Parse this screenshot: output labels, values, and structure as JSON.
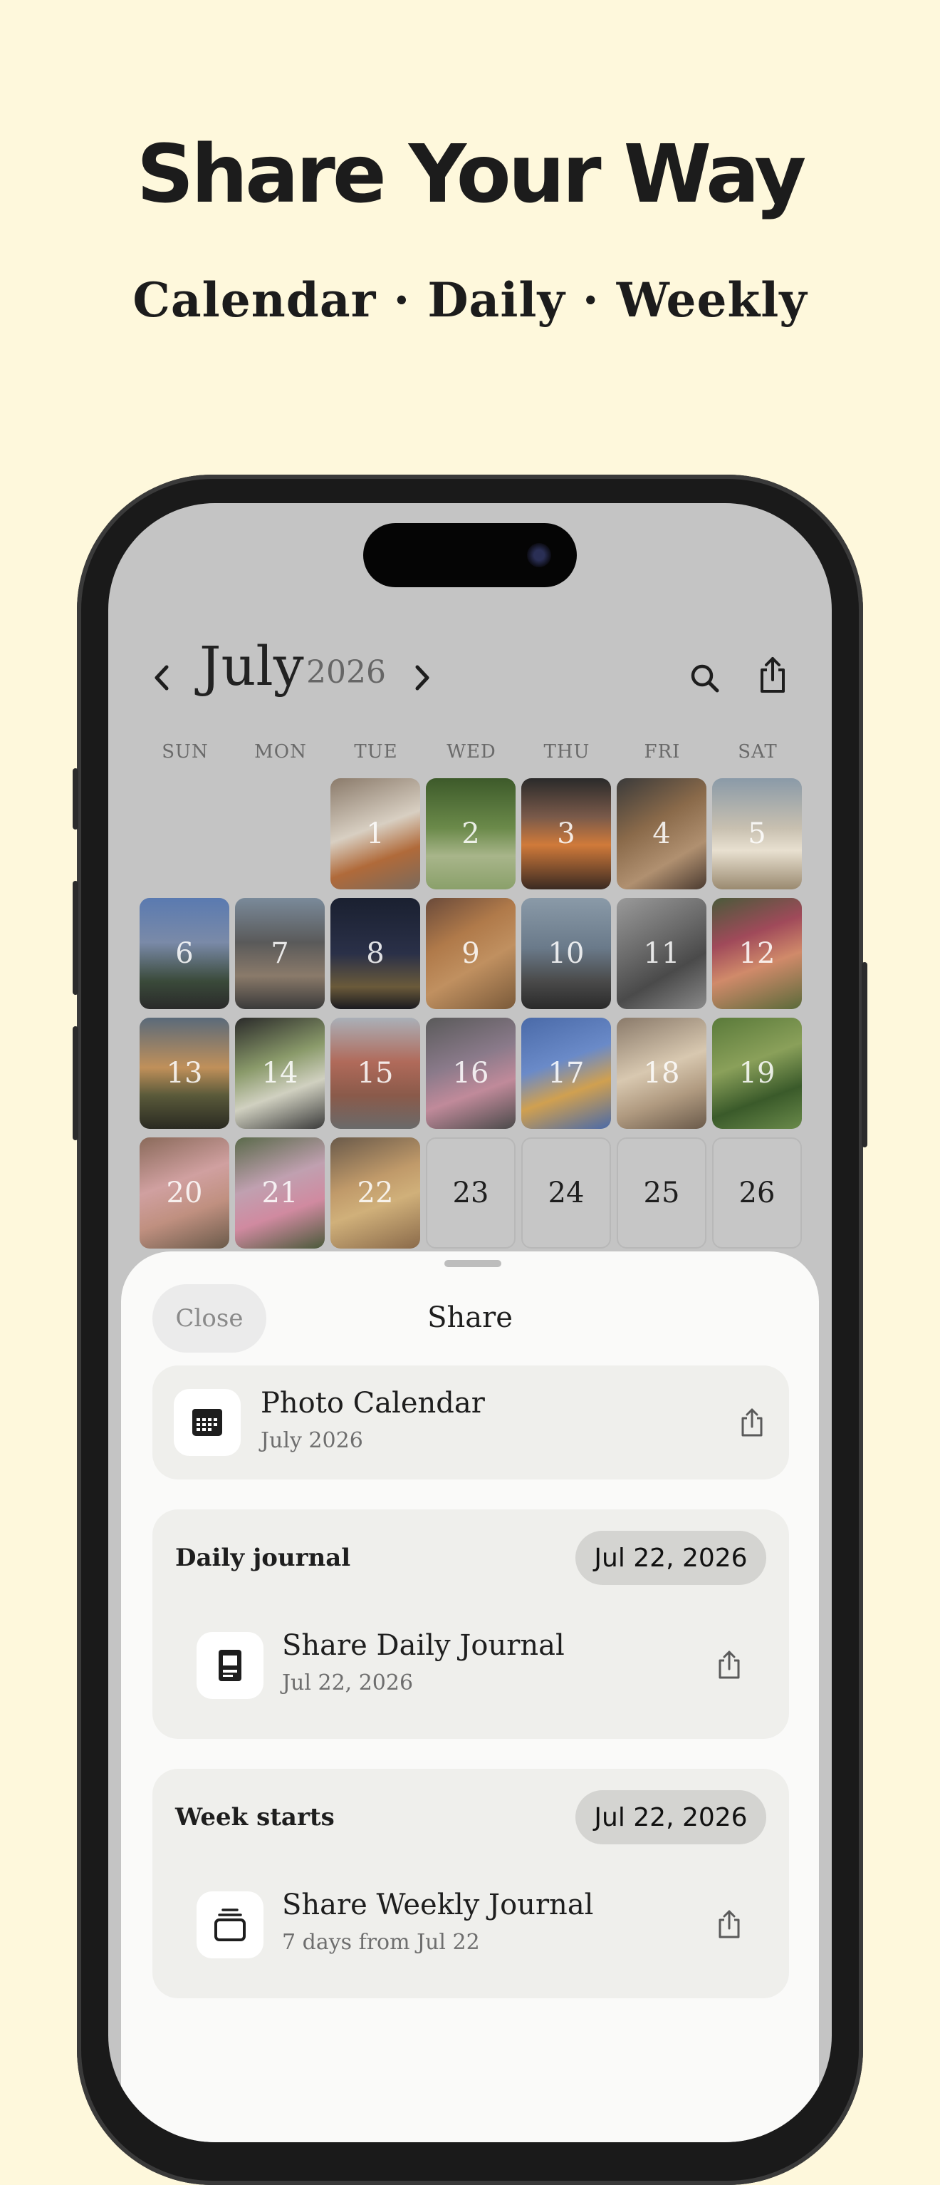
{
  "headline": "Share Your Way",
  "subhead": "Calendar · Daily · Weekly",
  "calendar": {
    "month": "July",
    "year": "2026",
    "weekdays": [
      "SUN",
      "MON",
      "TUE",
      "WED",
      "THU",
      "FRI",
      "SAT"
    ],
    "photo_days": [
      "1",
      "2",
      "3",
      "4",
      "5",
      "6",
      "7",
      "8",
      "9",
      "10",
      "11",
      "12",
      "13",
      "14",
      "15",
      "16",
      "17",
      "18",
      "19",
      "20",
      "21",
      "22"
    ],
    "empty_days": [
      "23",
      "24",
      "25",
      "26"
    ]
  },
  "icons": {
    "prev": "chevron-left-icon",
    "next": "chevron-right-icon",
    "search": "search-icon",
    "share": "share-icon"
  },
  "sheet": {
    "close_label": "Close",
    "title": "Share",
    "photo_calendar": {
      "title": "Photo Calendar",
      "subtitle": "July 2026"
    },
    "daily": {
      "section_label": "Daily journal",
      "date": "Jul 22, 2026",
      "title": "Share Daily Journal",
      "subtitle": "Jul 22, 2026"
    },
    "weekly": {
      "section_label": "Week starts",
      "date": "Jul 22, 2026",
      "title": "Share Weekly Journal",
      "subtitle": "7 days from Jul 22"
    }
  },
  "colors": {
    "background": "#fef8dc",
    "screen_dim": "#c4c4c4",
    "sheet": "#fafaf9",
    "card": "#efefec",
    "pill": "#d4d4d1"
  }
}
